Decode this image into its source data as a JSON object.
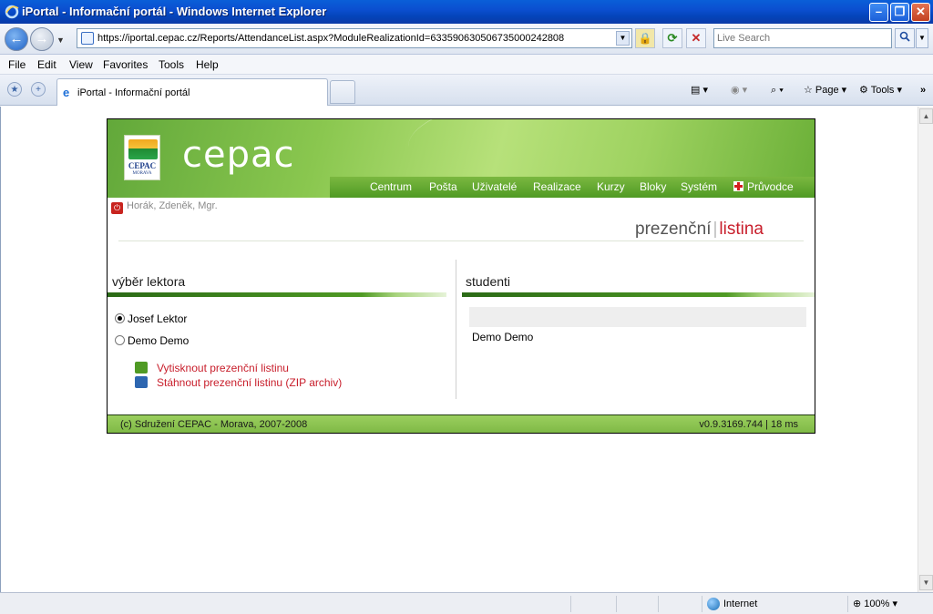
{
  "window": {
    "title": "iPortal - Informační portál - Windows Internet Explorer"
  },
  "toolbar": {
    "url": "https://iportal.cepac.cz/Reports/AttendanceList.aspx?ModuleRealizationId=633590630506735000242808",
    "search_placeholder": "Live Search"
  },
  "menu": [
    "File",
    "Edit",
    "View",
    "Favorites",
    "Tools",
    "Help"
  ],
  "tab": {
    "label": "iPortal - Informační portál"
  },
  "commands": {
    "page": "Page",
    "tools": "Tools"
  },
  "site": {
    "brand": "cepac",
    "logo_text": "CEPAC",
    "logo_subtext": "MORAVA",
    "nav": [
      "Centrum",
      "Pošta",
      "Uživatelé",
      "Realizace",
      "Kurzy",
      "Bloky",
      "Systém",
      "Průvodce"
    ],
    "user": "Horák, Zdeněk, Mgr.",
    "title_part1": "prezenční",
    "title_sep": "|",
    "title_part2": "listina",
    "lecturer_heading": "výběr lektora",
    "lecturers": [
      {
        "name": "Josef Lektor",
        "selected": true
      },
      {
        "name": "Demo Demo",
        "selected": false
      }
    ],
    "actions": {
      "print": "Vytisknout prezenční listinu",
      "download": "Stáhnout prezenční listinu (ZIP archiv)"
    },
    "students_heading": "studenti",
    "students": [
      "Demo Demo"
    ],
    "footer_copy": "(c) Sdružení CEPAC - Morava, 2007-2008",
    "footer_version": "v0.9.3169.744 | 18 ms"
  },
  "status": {
    "zone": "Internet",
    "zoom": "100%"
  },
  "colors": {
    "accent_green": "#4f9a24",
    "accent_red": "#c81e2b",
    "ie_blue": "#0b4fd0"
  }
}
